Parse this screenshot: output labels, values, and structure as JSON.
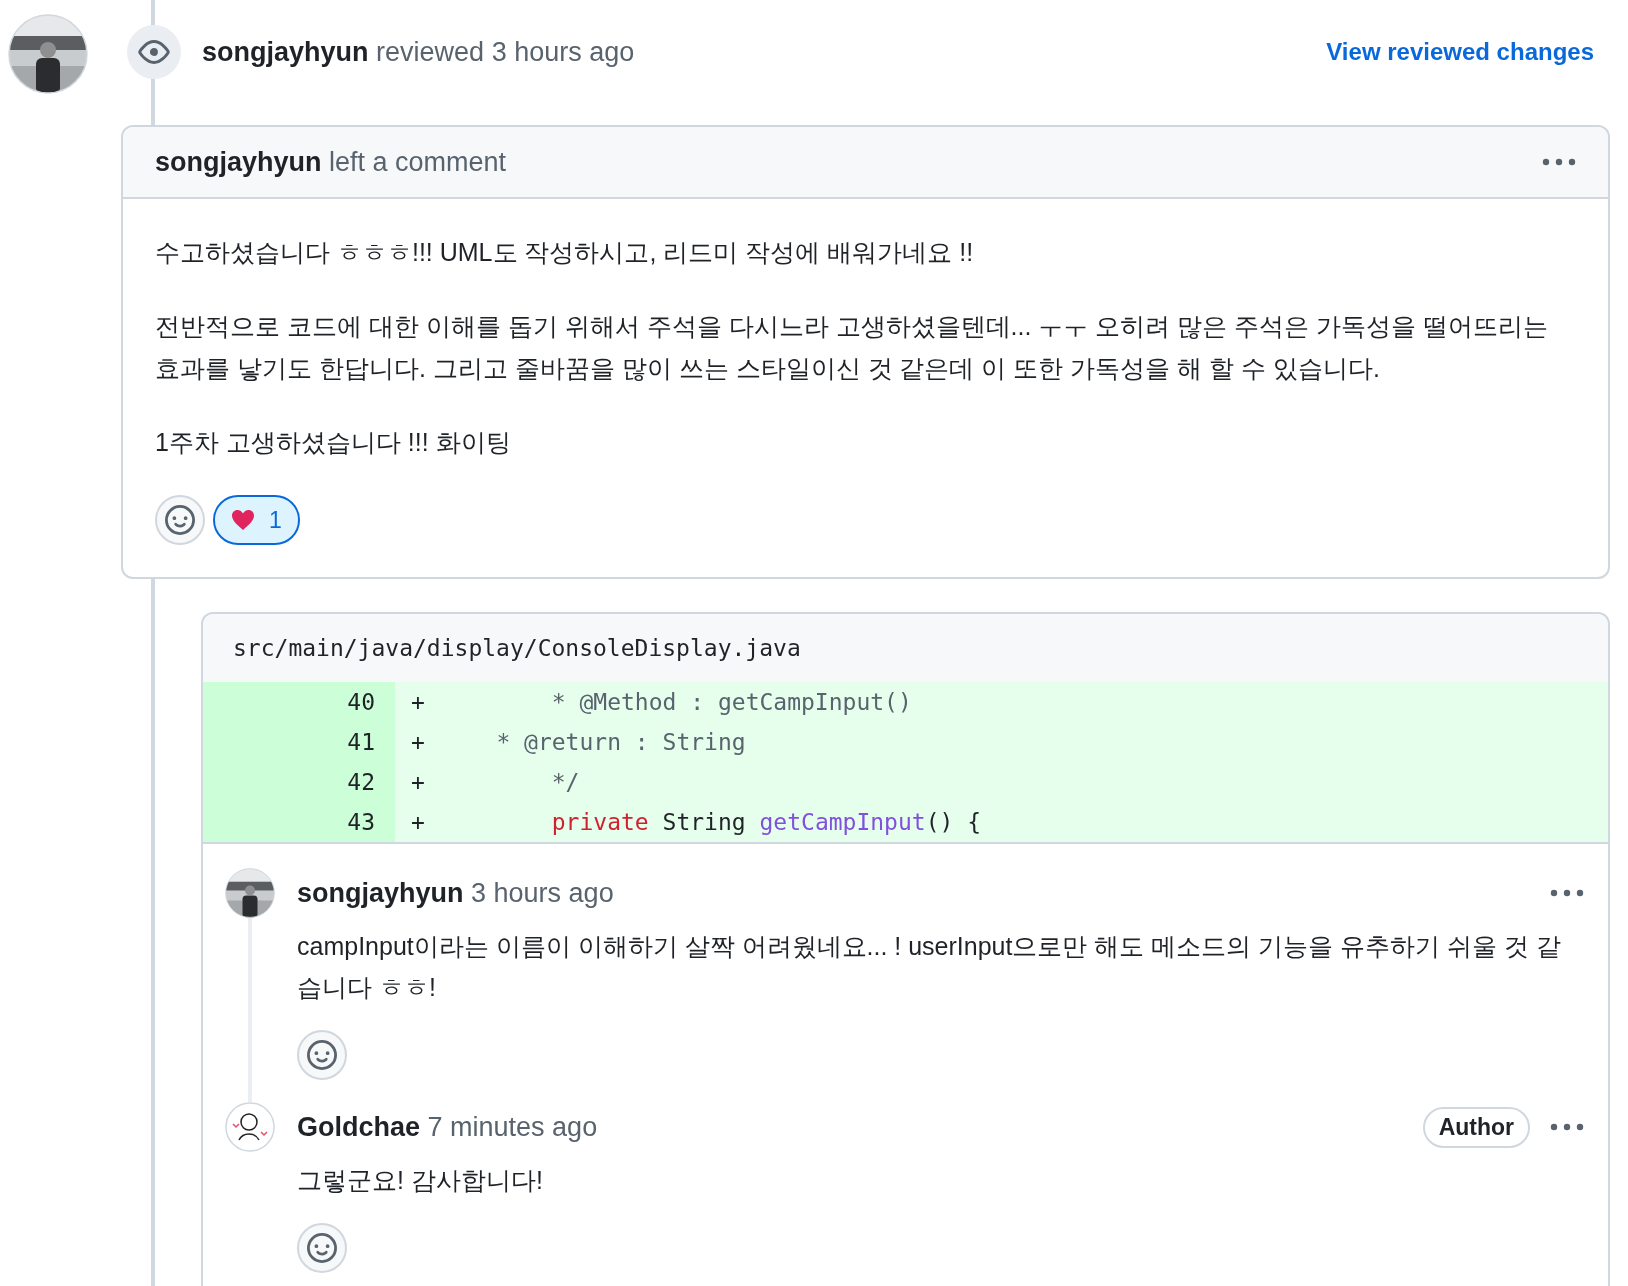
{
  "review": {
    "author": "songjayhyun",
    "action": "reviewed",
    "time": "3 hours ago",
    "link": "View reviewed changes"
  },
  "comment": {
    "author": "songjayhyun",
    "action": "left a comment",
    "paragraphs": [
      "수고하셨습니다 ㅎㅎㅎ!!! UML도 작성하시고, 리드미 작성에 배워가네요 !!",
      "전반적으로 코드에 대한 이해를 돕기 위해서 주석을 다시느라 고생하셨을텐데... ㅜㅜ 오히려 많은 주석은 가독성을 떨어뜨리는 효과를 낳기도 한답니다. 그리고 줄바꿈을 많이 쓰는 스타일이신 것 같은데 이 또한 가독성을 해 할 수 있습니다.",
      "1주차 고생하셨습니다 !!! 화이팅"
    ],
    "reactions": [
      {
        "count": "1",
        "selected": true
      }
    ]
  },
  "diff": {
    "file": "src/main/java/display/ConsoleDisplay.java",
    "lines": [
      {
        "number": "40",
        "sign": "+",
        "tokens": [
          {
            "kind": "comment",
            "text": "        * @Method : getCampInput()"
          }
        ]
      },
      {
        "number": "41",
        "sign": "+",
        "tokens": [
          {
            "kind": "comment",
            "text": "    * @return : String"
          }
        ]
      },
      {
        "number": "42",
        "sign": "+",
        "tokens": [
          {
            "kind": "comment",
            "text": "        */"
          }
        ]
      },
      {
        "number": "43",
        "sign": "+",
        "tokens": [
          {
            "kind": "keyword",
            "text": "        private"
          },
          {
            "kind": "plain",
            "text": " String "
          },
          {
            "kind": "function",
            "text": "getCampInput"
          },
          {
            "kind": "plain",
            "text": "() {"
          }
        ]
      }
    ]
  },
  "replies": [
    {
      "author": "songjayhyun",
      "time": "3 hours ago",
      "body": "campInput이라는 이름이 이해하기 살짝 어려웠네요... ! userInput으로만 해도 메소드의 기능을 유추하기 쉬울 것 같습니다 ㅎㅎ!"
    },
    {
      "author": "Goldchae",
      "time": "7 minutes ago",
      "badge": "Author",
      "body": "그렇군요! 감사합니다!"
    }
  ]
}
